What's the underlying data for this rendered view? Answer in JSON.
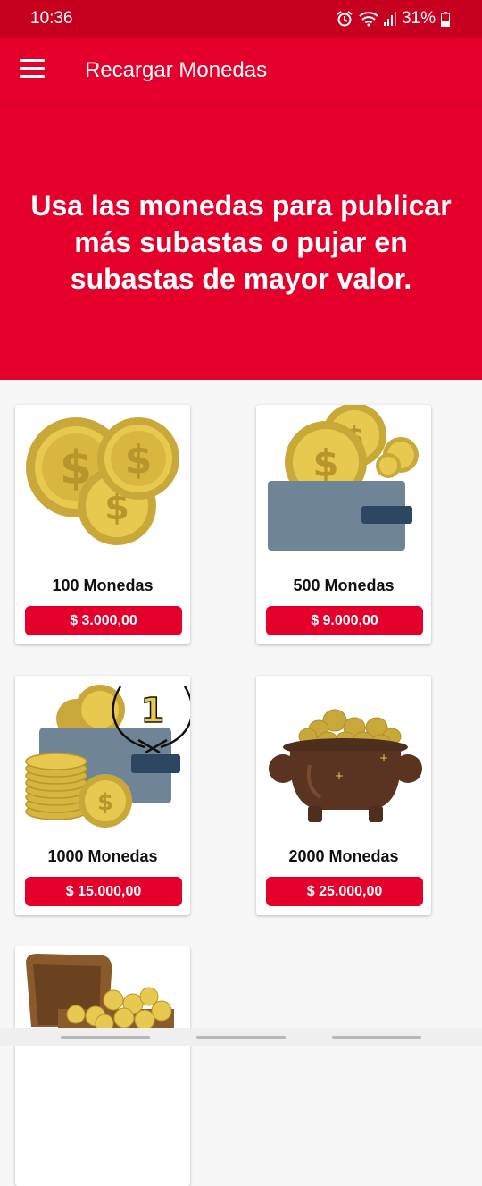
{
  "status": {
    "time": "10:36",
    "battery": "31%",
    "icons": [
      "alarm-icon",
      "wifi-icon",
      "signal-icon",
      "battery-icon"
    ]
  },
  "appbar": {
    "title": "Recargar Monedas",
    "menu_icon": "hamburger-menu-icon"
  },
  "hero": {
    "text": "Usa las monedas para publicar más subastas o pujar en subastas de mayor valor."
  },
  "packages": [
    {
      "label": "100 Monedas",
      "price": "$ 3.000,00",
      "icon": "coins-icon"
    },
    {
      "label": "500 Monedas",
      "price": "$ 9.000,00",
      "icon": "wallet-coins-icon"
    },
    {
      "label": "1000 Monedas",
      "price": "$ 15.000,00",
      "icon": "wallet-coin-stack-icon",
      "badge": "1"
    },
    {
      "label": "2000 Monedas",
      "price": "$ 25.000,00",
      "icon": "pot-of-gold-icon"
    },
    {
      "icon": "treasure-chest-icon"
    }
  ],
  "colors": {
    "primary": "#e4002b",
    "status_bar": "#c8001f",
    "gold": "#e6c54a",
    "wallet": "#6f8597"
  }
}
